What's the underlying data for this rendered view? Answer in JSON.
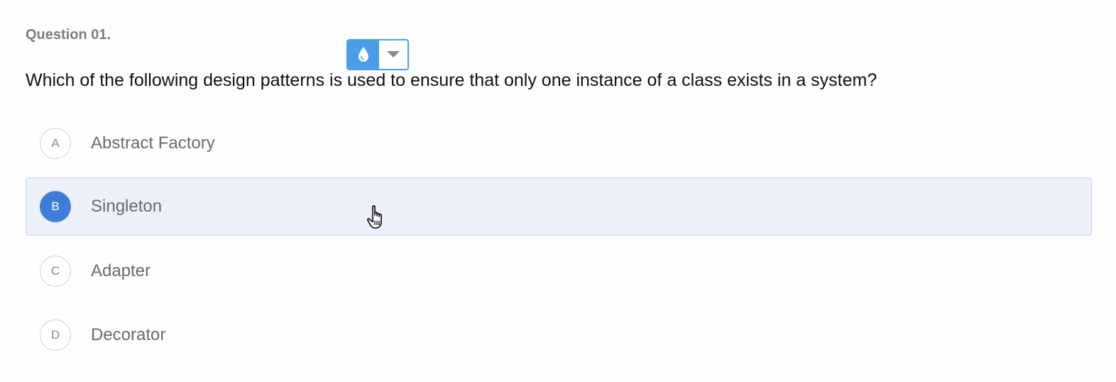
{
  "question": {
    "number": "Question 01.",
    "text": "Which of the following design patterns is used to ensure that only one instance of a class exists in a system?"
  },
  "toolbar": {
    "color_icon": "water-drop-icon",
    "dropdown_icon": "caret-down-icon",
    "accent_color": "#4a9ee6"
  },
  "options": [
    {
      "letter": "A",
      "label": "Abstract Factory",
      "selected": false
    },
    {
      "letter": "B",
      "label": "Singleton",
      "selected": true
    },
    {
      "letter": "C",
      "label": "Adapter",
      "selected": false
    },
    {
      "letter": "D",
      "label": "Decorator",
      "selected": false
    }
  ],
  "colors": {
    "selected_background": "#ebf0fa",
    "selected_badge": "#3e7dd8"
  },
  "cursor": {
    "icon": "hand-pointer-icon"
  }
}
